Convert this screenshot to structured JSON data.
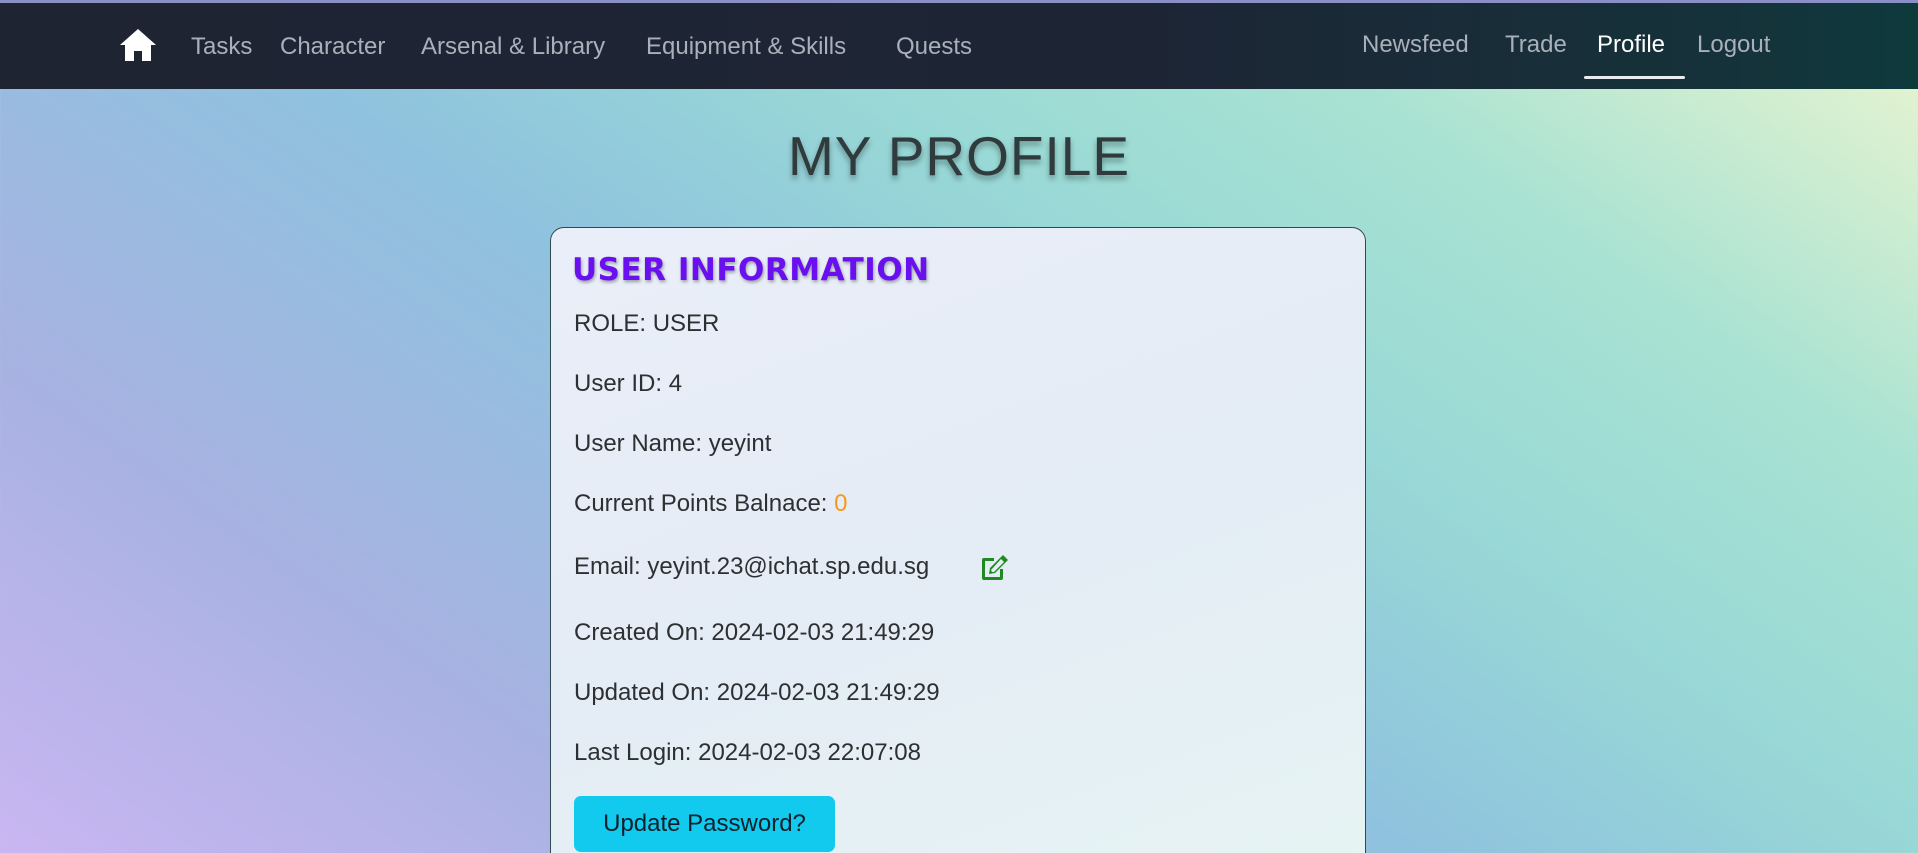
{
  "navbar": {
    "home_icon": "home-icon",
    "left_links": [
      "Tasks",
      "Character",
      "Arsenal & Library",
      "Equipment & Skills",
      "Quests"
    ],
    "right_links": [
      "Newsfeed",
      "Trade",
      "Profile",
      "Logout"
    ],
    "active_link": "Profile"
  },
  "page": {
    "title": "MY PROFILE"
  },
  "user_info": {
    "heading": "USER INFORMATION",
    "role_label": "ROLE: ",
    "role": "USER",
    "user_id_label": "User ID: ",
    "user_id": "4",
    "user_name_label": "User Name: ",
    "user_name": "yeyint",
    "points_label": "Current Points Balnace: ",
    "points": "0",
    "email_label": "Email: ",
    "email": "yeyint.23@ichat.sp.edu.sg",
    "edit_icon": "edit-icon",
    "created_label": "Created On: ",
    "created": "2024-02-03 21:49:29",
    "updated_label": "Updated On: ",
    "updated": "2024-02-03 21:49:29",
    "last_login_label": "Last Login: ",
    "last_login": "2024-02-03 22:07:08",
    "update_password_button": "Update Password?"
  },
  "colors": {
    "heading_purple": "#6a10f0",
    "points_orange": "#f39a1d",
    "button_cyan": "#12c9ee",
    "edit_icon_green": "#1f8a1f",
    "navbar_dark": "#1f2432"
  }
}
